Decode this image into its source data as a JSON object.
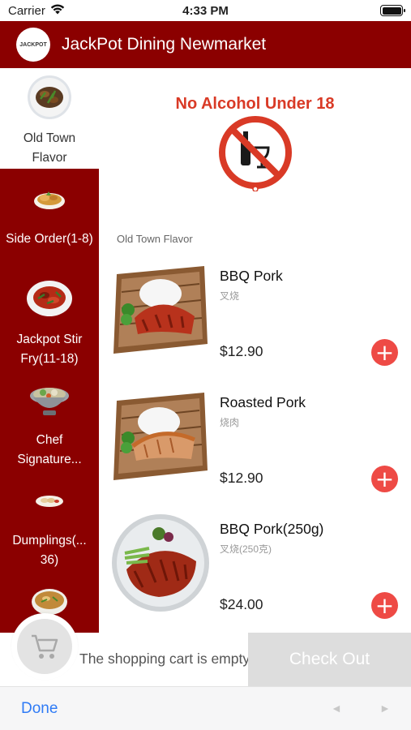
{
  "status_bar": {
    "carrier": "Carrier",
    "time": "4:33 PM"
  },
  "header": {
    "logo_text": "JACKPOT",
    "title": "JackPot Dining Newmarket"
  },
  "sidebar": {
    "categories": [
      {
        "label": "Old Town Flavor",
        "active": true
      },
      {
        "label": "Side Order(1-8)",
        "active": false
      },
      {
        "label": "Jackpot Stir Fry(11-18)",
        "active": false
      },
      {
        "label": "Chef Signature...",
        "active": false
      },
      {
        "label": "Dumplings(... 36)",
        "active": false
      },
      {
        "label": "",
        "active": false
      }
    ]
  },
  "notice": {
    "title": "No Alcohol Under 18"
  },
  "section": {
    "label": "Old Town Flavor"
  },
  "items": [
    {
      "name": "BBQ Pork",
      "cn_name": "叉烧",
      "price": "$12.90"
    },
    {
      "name": "Roasted Pork",
      "cn_name": "烧肉",
      "price": "$12.90"
    },
    {
      "name": "BBQ Pork(250g)",
      "cn_name": "叉烧(250克)",
      "price": "$24.00"
    }
  ],
  "cart": {
    "empty_text": "The shopping cart is empty",
    "checkout_label": "Check Out"
  },
  "toolbar": {
    "done_label": "Done",
    "prev": "◄",
    "next": "►"
  },
  "colors": {
    "brand": "#8b0000",
    "add_button": "#ee4a45",
    "notice": "#d93a26",
    "link": "#2f7bf6"
  }
}
